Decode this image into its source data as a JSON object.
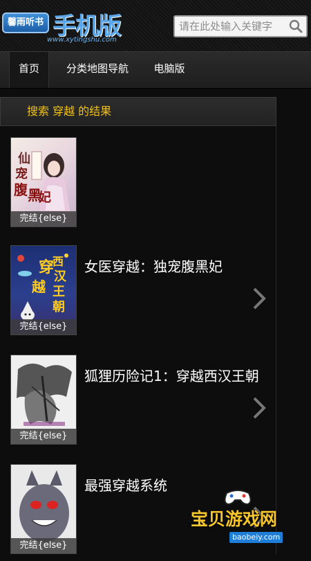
{
  "header": {
    "logo_badge": "馨雨听书",
    "logo_title": "手机版",
    "logo_url": "www.xytingshu.com",
    "search_placeholder": "请在此处输入关键字",
    "search_icon": "search-icon"
  },
  "nav": {
    "items": [
      {
        "label": "首页",
        "active": true
      },
      {
        "label": "分类地图导航",
        "active": false
      },
      {
        "label": "电脑版",
        "active": false
      }
    ]
  },
  "results": {
    "heading": "搜索 穿越 的结果",
    "books": [
      {
        "title": "",
        "status": "完结{else}",
        "cover_text": "仙宠腹黑妃"
      },
      {
        "title": "女医穿越：独宠腹黑妃",
        "status": "完结{else}",
        "cover_text": "穿越西汉王朝"
      },
      {
        "title": "狐狸历险记1：穿越西汉王朝",
        "status": "完结{else}",
        "cover_text": ""
      },
      {
        "title": "最强穿越系统",
        "status": "完结{else}",
        "cover_text": ""
      }
    ]
  },
  "watermark": {
    "text": "宝贝游戏网",
    "url": "baobeiy.com"
  },
  "colors": {
    "accent": "#f2c11a",
    "background": "#0d0d0d",
    "logo_blue": "#3f8fd6"
  }
}
